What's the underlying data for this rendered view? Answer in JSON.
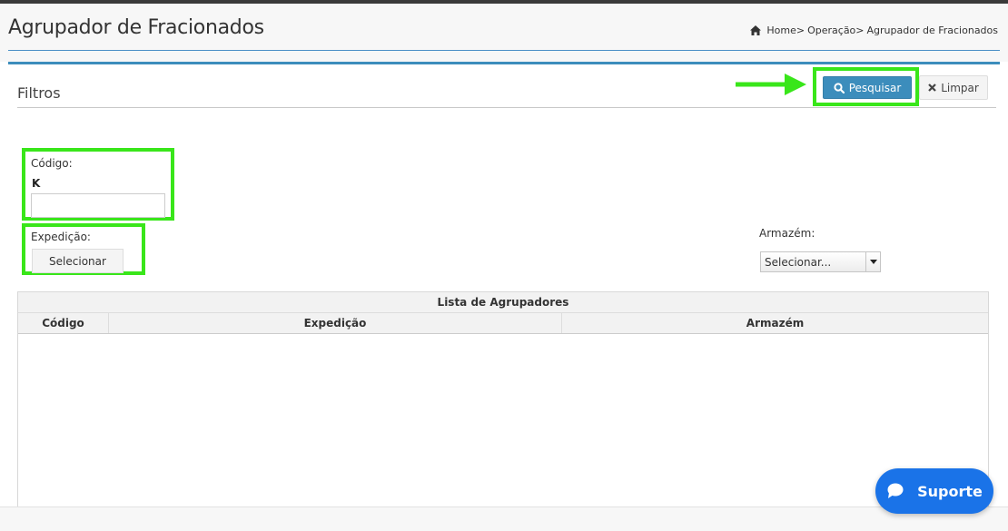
{
  "header": {
    "title": "Agrupador de Fracionados",
    "breadcrumb": [
      "Home>",
      "Operação>",
      "Agrupador de Fracionados"
    ]
  },
  "filters": {
    "title": "Filtros",
    "search_label": "Pesquisar",
    "clear_label": "Limpar",
    "codigo_label": "Código:",
    "codigo_value": "K",
    "expedicao_label": "Expedição:",
    "select_button_label": "Selecionar",
    "armazem_label": "Armazém:",
    "armazem_selected": "Selecionar..."
  },
  "table": {
    "caption": "Lista de Agrupadores",
    "columns": [
      "Código",
      "Expedição",
      "Armazém"
    ],
    "rows": []
  },
  "support": {
    "label": "Suporte"
  },
  "colors": {
    "accent": "#3c8dbc",
    "highlight": "#39e61a",
    "support": "#1a73e8"
  }
}
